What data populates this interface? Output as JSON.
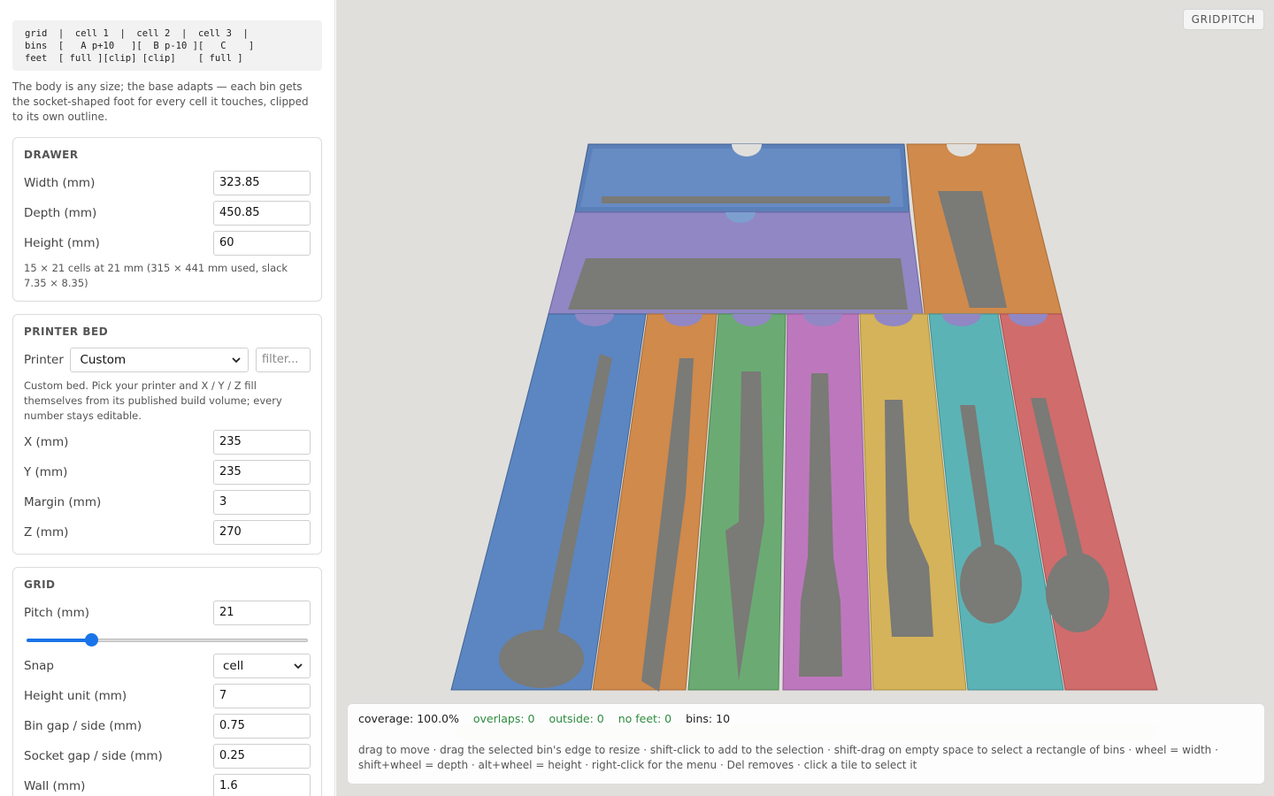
{
  "sidebar": {
    "legend_text": "grid  |  cell 1  |  cell 2  |  cell 3  |\nbins  [   A p+10   ][  B p-10 ][   C    ]\nfeet  [ full ][clip] [clip]    [ full ]",
    "description": "The body is any size; the base adapts — each bin gets the socket-shaped foot for every cell it touches, clipped to its own outline."
  },
  "drawer": {
    "title": "DRAWER",
    "width_label": "Width (mm)",
    "width_value": "323.85",
    "depth_label": "Depth (mm)",
    "depth_value": "450.85",
    "height_label": "Height (mm)",
    "height_value": "60",
    "note": "15 × 21 cells at 21 mm (315 × 441 mm used, slack 7.35 × 8.35)"
  },
  "printer": {
    "title": "PRINTER BED",
    "printer_label": "Printer",
    "printer_value": "Custom",
    "filter_placeholder": "filter...",
    "note": "Custom bed. Pick your printer and X / Y / Z fill themselves from its published build volume; every number stays editable.",
    "x_label": "X (mm)",
    "x_value": "235",
    "y_label": "Y (mm)",
    "y_value": "235",
    "margin_label": "Margin (mm)",
    "margin_value": "3",
    "z_label": "Z (mm)",
    "z_value": "270"
  },
  "grid": {
    "title": "GRID",
    "pitch_label": "Pitch (mm)",
    "pitch_value": "21",
    "pitch_slider_fraction": 0.23,
    "snap_label": "Snap",
    "snap_value": "cell",
    "height_unit_label": "Height unit (mm)",
    "height_unit_value": "7",
    "bin_gap_label": "Bin gap / side (mm)",
    "bin_gap_value": "0.75",
    "socket_gap_label": "Socket gap / side (mm)",
    "socket_gap_value": "0.25",
    "wall_label": "Wall (mm)",
    "wall_value": "1.6"
  },
  "viewport": {
    "brand": "GRIDPITCH",
    "colors": {
      "background": "#e0dfdc",
      "insert": "#7a7a76",
      "bins": [
        "#5b7fb8",
        "#9087c4",
        "#c98a4f",
        "#5b86c2",
        "#cf8a4c",
        "#6bab73",
        "#bd78bd",
        "#d5b35a",
        "#5cb3b5",
        "#d06c6c"
      ]
    },
    "icons": [
      "spoon-icon",
      "knife-icon",
      "fork-icon"
    ]
  },
  "status": {
    "coverage": "coverage: 100.0%",
    "overlaps": "overlaps: 0",
    "outside": "outside: 0",
    "no_feet": "no feet: 0",
    "bins": "bins: 10",
    "hint": "drag to move · drag the selected bin's edge to resize · shift-click to add to the selection · shift-drag on empty space to select a rectangle of bins · wheel = width · shift+wheel = depth · alt+wheel = height · right-click for the menu · Del removes · click a tile to select it"
  }
}
